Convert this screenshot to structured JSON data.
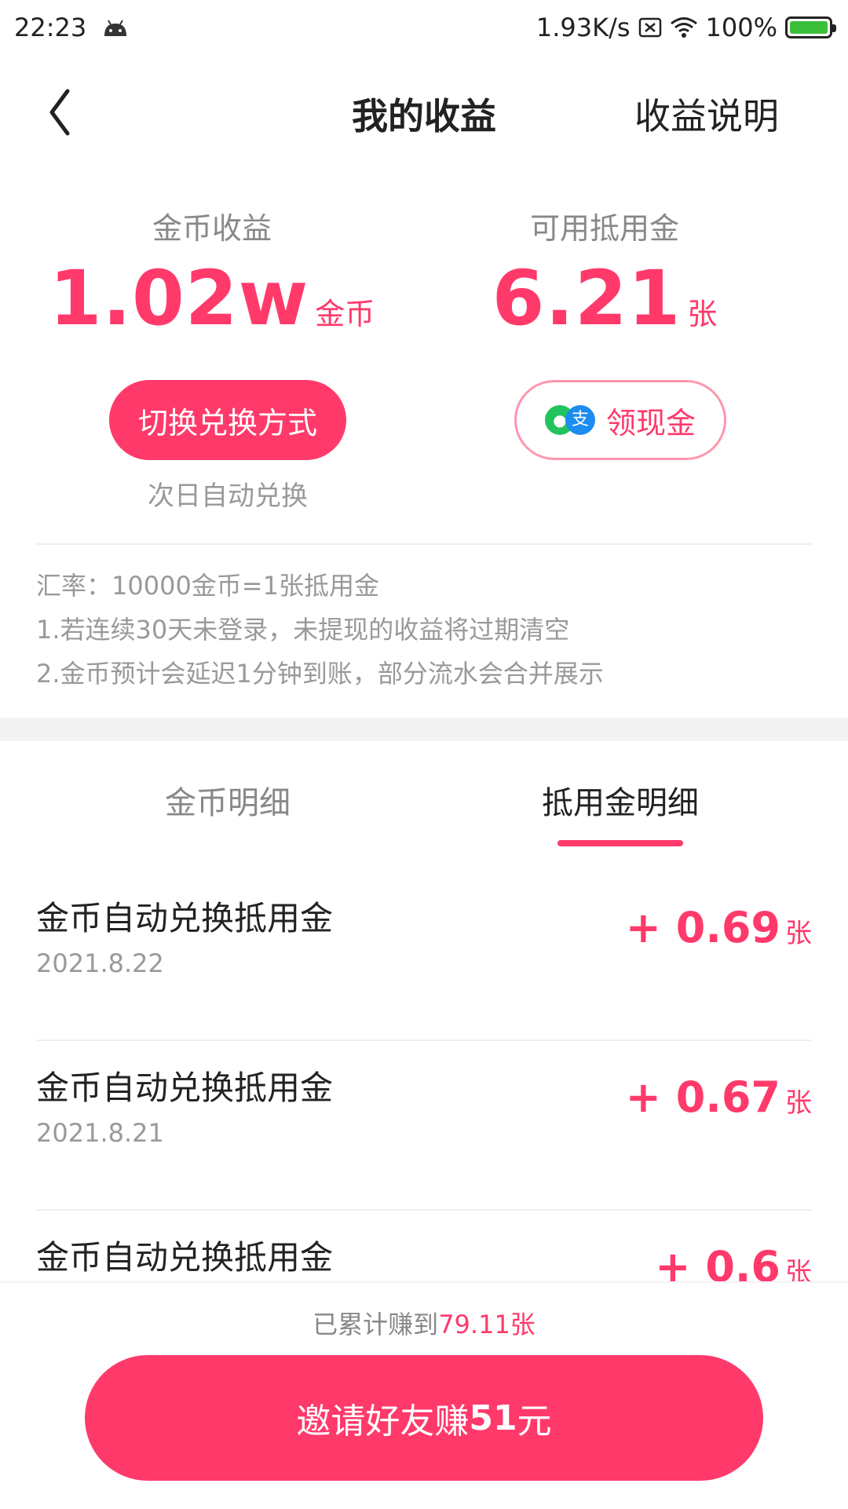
{
  "status_bar": {
    "time": "22:23",
    "net_speed": "1.93K/s",
    "battery": "100%",
    "icons": [
      "android-icon",
      "sim-off-icon",
      "wifi-icon",
      "battery-charging-icon"
    ]
  },
  "nav": {
    "title": "我的收益",
    "explain": "收益说明",
    "back_icon": "chevron-left-icon"
  },
  "summary": {
    "coin": {
      "label": "金币收益",
      "value": "1.02w",
      "unit": "金币"
    },
    "voucher": {
      "label": "可用抵用金",
      "value": "6.21",
      "unit": "张"
    },
    "switch_button": "切换兑换方式",
    "auto_note": "次日自动兑换",
    "cash_button": "领现金",
    "cash_icons": {
      "wechat": "wechat-pay-icon",
      "alipay": "alipay-icon",
      "alipay_glyph": "支"
    }
  },
  "rules": [
    "汇率：10000金币=1张抵用金",
    "1.若连续30天未登录，未提现的收益将过期清空",
    "2.金币预计会延迟1分钟到账，部分流水会合并展示"
  ],
  "tabs": [
    {
      "label": "金币明细",
      "active": false
    },
    {
      "label": "抵用金明细",
      "active": true
    }
  ],
  "records": [
    {
      "title": "金币自动兑换抵用金",
      "date": "2021.8.22",
      "amount": "+ 0.69",
      "unit": "张"
    },
    {
      "title": "金币自动兑换抵用金",
      "date": "2021.8.21",
      "amount": "+ 0.67",
      "unit": "张"
    },
    {
      "title": "金币自动兑换抵用金",
      "date": "",
      "amount": "+ 0.6",
      "unit": "张"
    }
  ],
  "footer": {
    "earned_prefix": "已累计赚到",
    "earned_value": "79.11张",
    "invite_prefix": "邀请好友赚",
    "invite_amount": "51",
    "invite_suffix": "元"
  },
  "colors": {
    "accent": "#ff3a6b",
    "muted": "#999999",
    "text": "#222222"
  }
}
